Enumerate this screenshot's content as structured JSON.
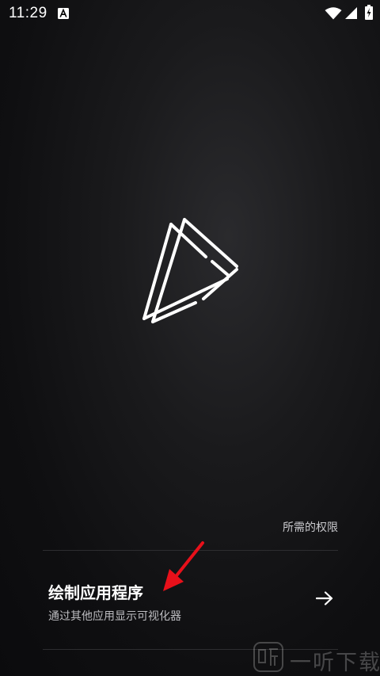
{
  "status_bar": {
    "time": "11:29",
    "icons": [
      "a-notification-icon",
      "wifi-icon",
      "signal-icon",
      "battery-icon"
    ]
  },
  "app": {
    "logo_icon": "triangle-play-logo"
  },
  "permissions": {
    "section_label": "所需的权限",
    "items": [
      {
        "title": "绘制应用程序",
        "description": "通过其他应用显示可视化器",
        "icon": "arrow-right-icon"
      }
    ]
  },
  "watermark": {
    "text": "一听下载"
  },
  "colors": {
    "background": "#0e0e10",
    "text_primary": "#ffffff",
    "text_secondary": "#bdbdc1",
    "annotation": "#e8101a"
  }
}
